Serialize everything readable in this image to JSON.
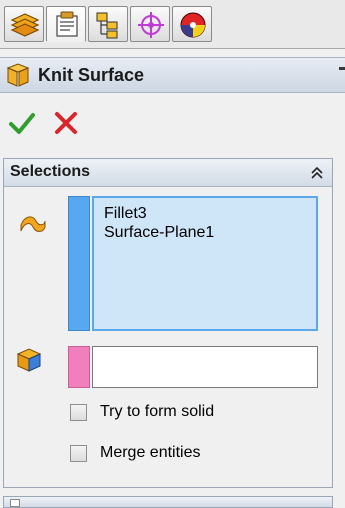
{
  "colors": {
    "accent_blue": "#58a8f0",
    "accent_pink": "#f27fbd",
    "ok_green": "#2f9e2f",
    "cancel_red": "#d8262a",
    "list_bg": "#cfe6f9"
  },
  "tabs": [
    {
      "icon": "feature-manager-icon",
      "active": false
    },
    {
      "icon": "property-manager-icon",
      "active": true
    },
    {
      "icon": "configuration-manager-icon",
      "active": false
    },
    {
      "icon": "dimxpert-manager-icon",
      "active": false
    },
    {
      "icon": "display-manager-icon",
      "active": false
    }
  ],
  "title_bar": {
    "title": "Knit Surface",
    "icon": "knit-surface-icon"
  },
  "actions": {
    "ok_icon": "checkmark-icon",
    "cancel_icon": "x-icon"
  },
  "selections_group": {
    "title": "Selections",
    "collapse_icon": "double-chevron-up-icon",
    "faces_icon": "surface-faces-icon",
    "items": [
      "Fillet3",
      "Surface-Plane1"
    ],
    "second_icon": "seed-face-icon",
    "second_value": "",
    "options": [
      {
        "label": "Try to form solid",
        "checked": false
      },
      {
        "label": "Merge entities",
        "checked": false
      }
    ]
  }
}
